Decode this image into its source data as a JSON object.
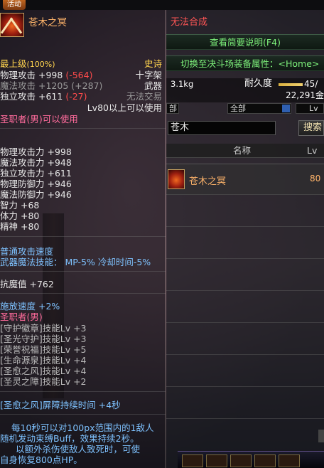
{
  "game_top": {
    "tab_label": "活动"
  },
  "tooltip": {
    "item_name": "苍木之冥",
    "max_level_label": "最上级",
    "max_level_pct": "(100%)",
    "rarity": "史诗",
    "weapon_type": "十字架",
    "category": "武器",
    "tradable": "无法交易",
    "level_req": "Lv80以上可以使用",
    "class_req": "圣职者(男)可以使用",
    "attack_lines": [
      {
        "label": "物理攻击",
        "value": "+998",
        "diff": "(-564)"
      },
      {
        "label": "魔法攻击",
        "value": "+1205",
        "diff": "(+287)"
      },
      {
        "label": "独立攻击",
        "value": "+611",
        "diff": "(-27)"
      }
    ],
    "stats": [
      "物理攻击力 +998",
      "魔法攻击力 +948",
      "独立攻击力 +611",
      "物理防御力 +946",
      "魔法防御力 +946",
      "智力 +68",
      "体力 +80",
      "精神 +80"
    ],
    "attack_speed": "普通攻击速度",
    "weapon_skill": "武器魔法技能： MP-5% 冷却时间-5%",
    "magic_resist": "抗魔值 +762",
    "cast_speed": "施放速度 +2%",
    "class_line": "圣职者(男)",
    "skills": [
      "[守护徽章]技能Lv +3",
      "[圣光守护]技能Lv +3",
      "[荣誉祝福]技能Lv +5",
      "[生命源泉]技能Lv +4",
      "[圣愈之风]技能Lv +4",
      "[圣灵之障]技能Lv +2"
    ],
    "barrier": "[圣愈之风]屏障持续时间 +4秒",
    "desc_lines": [
      "每10秒可以对100px范围内的1敌人",
      "随机发动束缚Buff，效果持续2秒。",
      "以额外杀伤使敌人致死时，可使",
      "自身恢复800点HP。"
    ]
  },
  "panel": {
    "cannot_synth": "无法合成",
    "view_brief": "查看简要说明(F4)",
    "switch_arena": "切换至决斗场装备属性：<Home>",
    "weight": "3.1kg",
    "durability_label": "耐久度",
    "durability_value": "45/",
    "money": "22,291金",
    "filter_1": "部",
    "filter_2": "全部",
    "filter_3": "Lv",
    "search_value": "苍木",
    "search_button": "搜索",
    "col_name": "名称",
    "col_lv": "Lv",
    "results": [
      {
        "name": "苍木之冥",
        "lv": "80"
      }
    ]
  },
  "icons": [
    "cross-weapon-icon",
    "dropdown-arrow-icon",
    "scroll-handle-icon"
  ]
}
